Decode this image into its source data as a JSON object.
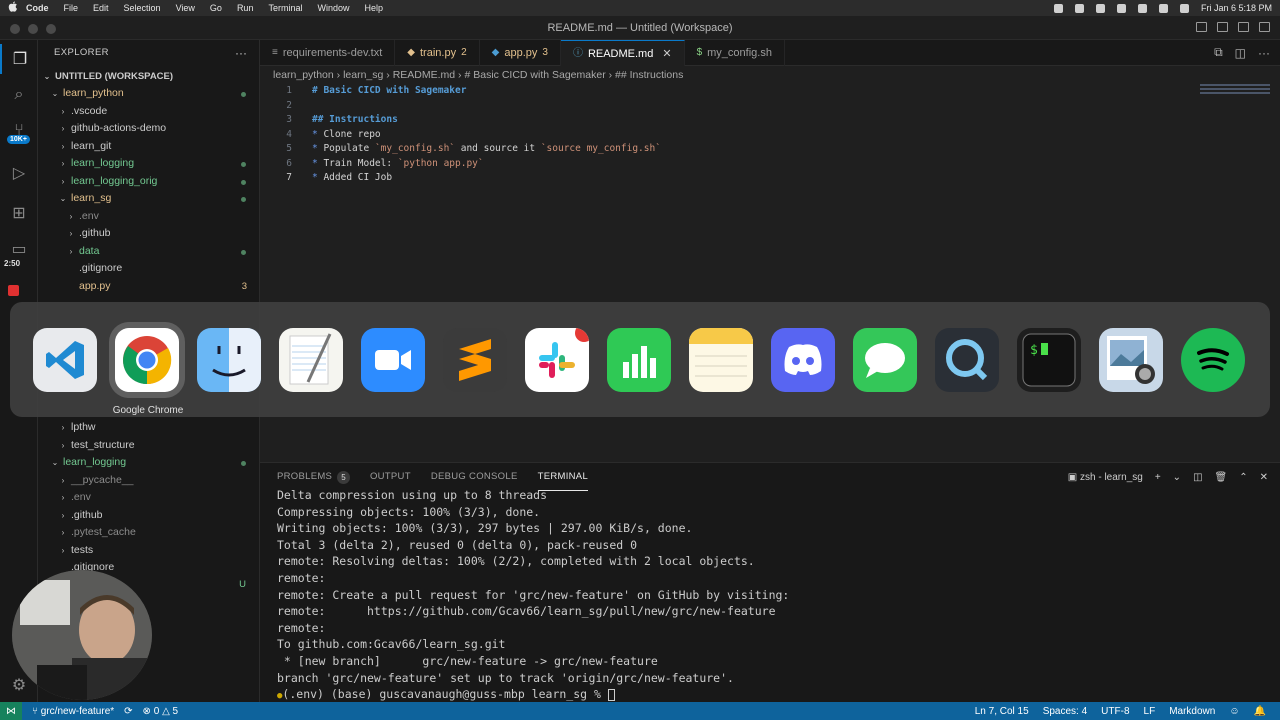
{
  "menubar": {
    "apple_icon": "apple-icon",
    "items": [
      "Code",
      "File",
      "Edit",
      "Selection",
      "View",
      "Go",
      "Run",
      "Terminal",
      "Window",
      "Help"
    ],
    "datetime": "Fri Jan 6  5:18 PM"
  },
  "window": {
    "title": "README.md — Untitled (Workspace)"
  },
  "activity_bar": {
    "extensions_badge": "10K+",
    "recording_timer": "2:50"
  },
  "explorer": {
    "header": "EXPLORER",
    "more": "···",
    "workspace": "UNTITLED (WORKSPACE)",
    "items": [
      {
        "label": "learn_python",
        "chev": "⌄",
        "indent": 1,
        "color": "#e2c08d",
        "dot": true
      },
      {
        "label": ".vscode",
        "chev": "›",
        "indent": 2,
        "color": "#cccccc"
      },
      {
        "label": "github-actions-demo",
        "chev": "›",
        "indent": 2,
        "color": "#cccccc"
      },
      {
        "label": "learn_git",
        "chev": "›",
        "indent": 2,
        "color": "#cccccc"
      },
      {
        "label": "learn_logging",
        "chev": "›",
        "indent": 2,
        "color": "#73c991",
        "dot": true
      },
      {
        "label": "learn_logging_orig",
        "chev": "›",
        "indent": 2,
        "color": "#73c991",
        "dot": true
      },
      {
        "label": "learn_sg",
        "chev": "⌄",
        "indent": 2,
        "color": "#e2c08d",
        "dot": true
      },
      {
        "label": ".env",
        "chev": "›",
        "indent": 3,
        "color": "#8c8c8c"
      },
      {
        "label": ".github",
        "chev": "›",
        "indent": 3,
        "color": "#cccccc"
      },
      {
        "label": "data",
        "chev": "›",
        "indent": 3,
        "color": "#73c991",
        "dot": true
      },
      {
        "label": ".gitignore",
        "chev": "",
        "indent": 3,
        "color": "#cccccc"
      },
      {
        "label": "app.py",
        "chev": "",
        "indent": 3,
        "color": "#e2c08d",
        "count": "3"
      }
    ],
    "items_lower": [
      {
        "label": "lpthw",
        "chev": "›",
        "indent": 2,
        "color": "#cccccc"
      },
      {
        "label": "test_structure",
        "chev": "›",
        "indent": 2,
        "color": "#cccccc"
      },
      {
        "label": "learn_logging",
        "chev": "⌄",
        "indent": 1,
        "color": "#73c991",
        "dot": true
      },
      {
        "label": "__pycache__",
        "chev": "›",
        "indent": 2,
        "color": "#8c8c8c"
      },
      {
        "label": ".env",
        "chev": "›",
        "indent": 2,
        "color": "#8c8c8c"
      },
      {
        "label": ".github",
        "chev": "›",
        "indent": 2,
        "color": "#cccccc"
      },
      {
        "label": ".pytest_cache",
        "chev": "›",
        "indent": 2,
        "color": "#8c8c8c"
      },
      {
        "label": "tests",
        "chev": "›",
        "indent": 2,
        "color": "#cccccc"
      },
      {
        "label": ".gitignore",
        "chev": "",
        "indent": 2,
        "color": "#cccccc"
      }
    ],
    "untracked_marker": "U"
  },
  "tabs": [
    {
      "label": "requirements-dev.txt",
      "icon": "≡",
      "icon_color": "#9d9d9d",
      "count": "",
      "active": false,
      "color": "#9d9d9d"
    },
    {
      "label": "train.py",
      "icon": "◆",
      "icon_color": "#e2c08d",
      "count": "2",
      "active": false,
      "color": "#e2c08d"
    },
    {
      "label": "app.py",
      "icon": "◆",
      "icon_color": "#4b9cd3",
      "count": "3",
      "active": false,
      "color": "#e2c08d"
    },
    {
      "label": "README.md",
      "icon": "ⓘ",
      "icon_color": "#519aba",
      "count": "",
      "active": true,
      "color": "#ffffff"
    },
    {
      "label": "my_config.sh",
      "icon": "$",
      "icon_color": "#89d185",
      "count": "",
      "active": false,
      "color": "#9d9d9d"
    }
  ],
  "breadcrumb": [
    "learn_python",
    "learn_sg",
    "README.md",
    "# Basic CICD with Sagemaker",
    "## Instructions"
  ],
  "code": {
    "cursor_line": 7,
    "lines": [
      "# Basic CICD with Sagemaker",
      "",
      "## Instructions",
      "* Clone repo",
      "* Populate `my_config.sh` and source it `source my_config.sh`",
      "* Train Model: `python app.py`",
      "* Added CI Job"
    ]
  },
  "panel": {
    "tabs": [
      "PROBLEMS",
      "OUTPUT",
      "DEBUG CONSOLE",
      "TERMINAL"
    ],
    "problems_count": "5",
    "active_tab": "TERMINAL",
    "terminal_name": "zsh - learn_sg"
  },
  "terminal": {
    "lines": [
      "Delta compression using up to 8 threads",
      "Compressing objects: 100% (3/3), done.",
      "Writing objects: 100% (3/3), 297 bytes | 297.00 KiB/s, done.",
      "Total 3 (delta 2), reused 0 (delta 0), pack-reused 0",
      "remote: Resolving deltas: 100% (2/2), completed with 2 local objects.",
      "remote:",
      "remote: Create a pull request for 'grc/new-feature' on GitHub by visiting:",
      "remote:      https://github.com/Gcav66/learn_sg/pull/new/grc/new-feature",
      "remote:",
      "To github.com:Gcav66/learn_sg.git",
      " * [new branch]      grc/new-feature -> grc/new-feature",
      "branch 'grc/new-feature' set up to track 'origin/grc/new-feature'."
    ],
    "prompt": "(.env) (base) guscavanaugh@guss-mbp learn_sg % "
  },
  "statusbar": {
    "branch": "grc/new-feature*",
    "errors": "0",
    "warnings": "5",
    "position": "Ln 7, Col 15",
    "spaces": "Spaces: 4",
    "encoding": "UTF-8",
    "eol": "LF",
    "language": "Markdown"
  },
  "app_switcher": {
    "selected_label": "Google Chrome",
    "apps": [
      {
        "name": "vscode-icon",
        "bg": "#e8eaed"
      },
      {
        "name": "chrome-icon",
        "bg": "#ffffff"
      },
      {
        "name": "finder-icon",
        "bg": "#6ab7f5"
      },
      {
        "name": "textedit-icon",
        "bg": "#f5f5f0"
      },
      {
        "name": "zoom-icon",
        "bg": "#2d8cff"
      },
      {
        "name": "sublime-icon",
        "bg": "#3b3b3b"
      },
      {
        "name": "slack-icon",
        "bg": "#ffffff"
      },
      {
        "name": "numbers-icon",
        "bg": "#2fc955"
      },
      {
        "name": "notes-icon",
        "bg": "#fdf8e5"
      },
      {
        "name": "discord-icon",
        "bg": "#5865f2"
      },
      {
        "name": "messages-icon",
        "bg": "#34c759"
      },
      {
        "name": "quicktime-icon",
        "bg": "#2a2f36"
      },
      {
        "name": "terminal-icon",
        "bg": "#1e1e1e"
      },
      {
        "name": "preview-icon",
        "bg": "#c8d8e8"
      },
      {
        "name": "spotify-icon",
        "bg": "#1db954"
      }
    ]
  }
}
